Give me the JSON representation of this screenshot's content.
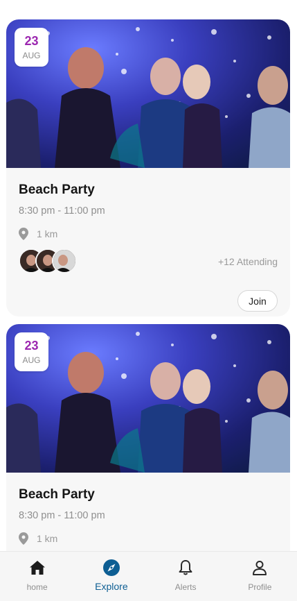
{
  "events": [
    {
      "date_day": "23",
      "date_month": "AUG",
      "title": "Beach Party",
      "time": "8:30 pm - 11:00 pm",
      "distance": "1 km",
      "attending": "+12 Attending",
      "join_label": "Join"
    },
    {
      "date_day": "23",
      "date_month": "AUG",
      "title": "Beach Party",
      "time": "8:30 pm - 11:00 pm",
      "distance": "1 km"
    }
  ],
  "nav": {
    "items": [
      {
        "label": "home",
        "icon": "home-icon"
      },
      {
        "label": "Explore",
        "icon": "compass-icon",
        "active": true
      },
      {
        "label": "Alerts",
        "icon": "bell-icon"
      },
      {
        "label": "Profile",
        "icon": "person-icon"
      }
    ]
  },
  "colors": {
    "accent": "#0d5e93",
    "date_day": "#9c27b0",
    "card_bg": "#f7f7f7"
  }
}
